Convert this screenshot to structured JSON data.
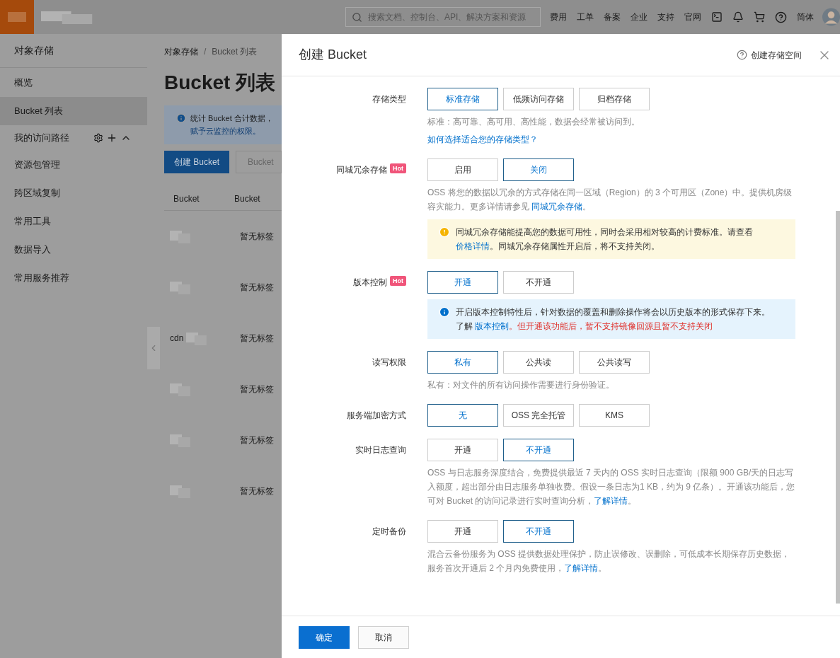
{
  "topbar": {
    "search": {
      "placeholder": "搜索文档、控制台、API、解决方案和资源"
    },
    "links": [
      "费用",
      "工单",
      "备案",
      "企业",
      "支持",
      "官网"
    ],
    "language": "简体"
  },
  "sidebar": {
    "title": "对象存储",
    "items": [
      {
        "label": "概览",
        "selected": false,
        "kind": "item"
      },
      {
        "label": "Bucket 列表",
        "selected": true,
        "kind": "item"
      },
      {
        "label": "我的访问路径",
        "selected": false,
        "kind": "group"
      },
      {
        "label": "资源包管理",
        "selected": false,
        "kind": "item"
      },
      {
        "label": "跨区域复制",
        "selected": false,
        "kind": "item"
      },
      {
        "label": "常用工具",
        "selected": false,
        "kind": "item"
      },
      {
        "label": "数据导入",
        "selected": false,
        "kind": "item"
      },
      {
        "label": "常用服务推荐",
        "selected": false,
        "kind": "item"
      }
    ]
  },
  "page": {
    "breadcrumb": {
      "items": [
        "对象存储",
        "Bucket 列表"
      ],
      "separator": "/"
    },
    "title": "Bucket 列表",
    "notice": {
      "text": "统计 Bucket 合计数据，",
      "link": "赋予云监控的权限。"
    },
    "create_button": "创建 Bucket",
    "search": {
      "placeholder": "Bucket"
    },
    "table": {
      "columns": [
        "Bucket",
        "Bucket"
      ],
      "rows": [
        {
          "tags": "暂无标签"
        },
        {
          "tags": "暂无标签"
        },
        {
          "name": "cdn",
          "tags": "暂无标签"
        },
        {
          "tags": "暂无标签"
        },
        {
          "tags": "暂无标签"
        },
        {
          "tags": "暂无标签"
        }
      ]
    }
  },
  "drawer": {
    "title": "创建 Bucket",
    "help_link": "创建存储空间",
    "sections": [
      {
        "label": "存储类型",
        "options": [
          {
            "label": "标准存储",
            "selected": true
          },
          {
            "label": "低频访问存储",
            "selected": false
          },
          {
            "label": "归档存储",
            "selected": false
          }
        ],
        "help": [
          [
            {
              "kind": "text",
              "text": "标准：高可靠、高可用、高性能，数据会经常被访问到。"
            }
          ],
          [
            {
              "kind": "link",
              "text": "如何选择适合您的存储类型？"
            }
          ]
        ]
      },
      {
        "label": "同城冗余存储",
        "badge": "Hot",
        "options": [
          {
            "label": "启用",
            "selected": false
          },
          {
            "label": "关闭",
            "selected": true
          }
        ],
        "help": [
          [
            {
              "kind": "text",
              "text": "OSS 将您的数据以冗余的方式存储在同一区域（Region）的 3 个可用区（Zone）中。提供机房级容灾能力。更多详情请参见 "
            },
            {
              "kind": "link",
              "text": "同城冗余存储"
            },
            {
              "kind": "text",
              "text": "。"
            }
          ]
        ],
        "notice": {
          "kind": "warning",
          "lines": [
            [
              {
                "kind": "text",
                "text": "同城冗余存储能提高您的数据可用性，同时会采用相对较高的计费标准。请查看"
              }
            ],
            [
              {
                "kind": "link",
                "text": "价格详情"
              },
              {
                "kind": "text",
                "text": "。同城冗余存储属性开启后，将不支持关闭。"
              }
            ]
          ]
        }
      },
      {
        "label": "版本控制",
        "badge": "Hot",
        "options": [
          {
            "label": "开通",
            "selected": true
          },
          {
            "label": "不开通",
            "selected": false
          }
        ],
        "notice": {
          "kind": "info",
          "lines": [
            [
              {
                "kind": "text",
                "text": "开启版本控制特性后，针对数据的覆盖和删除操作将会以历史版本的形式保存下来。"
              }
            ],
            [
              {
                "kind": "text",
                "text": "了解 "
              },
              {
                "kind": "link",
                "text": "版本控制"
              },
              {
                "kind": "danger",
                "text": "。但开通该功能后，暂不支持镜像回源且暂不支持关闭"
              }
            ]
          ]
        }
      },
      {
        "label": "读写权限",
        "options": [
          {
            "label": "私有",
            "selected": true
          },
          {
            "label": "公共读",
            "selected": false
          },
          {
            "label": "公共读写",
            "selected": false
          }
        ],
        "help": [
          [
            {
              "kind": "text",
              "text": "私有：对文件的所有访问操作需要进行身份验证。"
            }
          ]
        ]
      },
      {
        "label": "服务端加密方式",
        "options": [
          {
            "label": "无",
            "selected": true
          },
          {
            "label": "OSS 完全托管",
            "selected": false
          },
          {
            "label": "KMS",
            "selected": false
          }
        ]
      },
      {
        "label": "实时日志查询",
        "options": [
          {
            "label": "开通",
            "selected": false
          },
          {
            "label": "不开通",
            "selected": true
          }
        ],
        "help": [
          [
            {
              "kind": "text",
              "text": "OSS 与日志服务深度结合，免费提供最近 7 天内的 OSS 实时日志查询（限额 900 GB/天的日志写入额度，超出部分由日志服务单独收费。假设一条日志为1 KB，约为 9 亿条）。开通该功能后，您可对 Bucket 的访问记录进行实时查询分析，"
            },
            {
              "kind": "link",
              "text": "了解详情"
            },
            {
              "kind": "text",
              "text": "。"
            }
          ]
        ]
      },
      {
        "label": "定时备份",
        "options": [
          {
            "label": "开通",
            "selected": false
          },
          {
            "label": "不开通",
            "selected": true
          }
        ],
        "help": [
          [
            {
              "kind": "text",
              "text": "混合云备份服务为 OSS 提供数据处理保护，防止误修改、误删除，可低成本长期保存历史数据，服务首次开通后 2 个月内免费使用，"
            },
            {
              "kind": "link",
              "text": "了解详情"
            },
            {
              "kind": "text",
              "text": "。"
            }
          ]
        ]
      }
    ],
    "buttons": [
      {
        "label": "确定",
        "kind": "primary"
      },
      {
        "label": "取消",
        "kind": "default"
      }
    ]
  }
}
